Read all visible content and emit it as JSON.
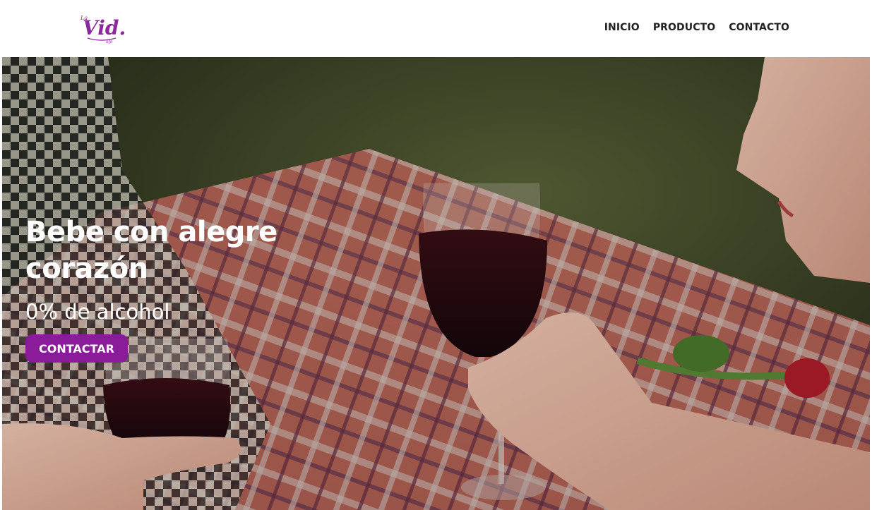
{
  "brand": {
    "logo_text": "Vid.",
    "logo_prefix": "La",
    "logo_suffix": "life",
    "color": "#8a2a9a"
  },
  "nav": {
    "items": [
      {
        "label": "INICIO"
      },
      {
        "label": "PRODUCTO"
      },
      {
        "label": "CONTACTO"
      }
    ]
  },
  "hero": {
    "title_line1": "Bebe con alegre",
    "title_line2": "corazón",
    "subtitle": "0% de alcohol",
    "button_label": "CONTACTAR",
    "button_color": "#8a1c9a",
    "image_icon": "wine-picnic-photo"
  }
}
